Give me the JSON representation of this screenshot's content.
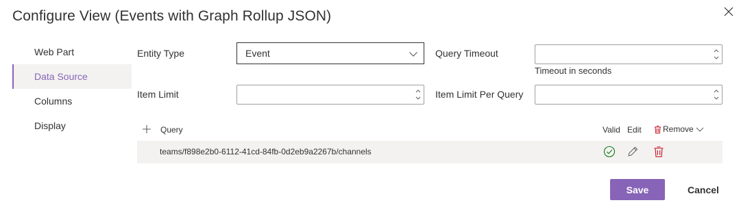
{
  "dialog": {
    "title": "Configure View (Events with Graph Rollup JSON)"
  },
  "nav": {
    "items": [
      {
        "label": "Web Part",
        "selected": false
      },
      {
        "label": "Data Source",
        "selected": true
      },
      {
        "label": "Columns",
        "selected": false
      },
      {
        "label": "Display",
        "selected": false
      }
    ]
  },
  "form": {
    "entity_type_label": "Entity Type",
    "entity_type_value": "Event",
    "query_timeout_label": "Query Timeout",
    "query_timeout_value": "",
    "query_timeout_hint": "Timeout in seconds",
    "item_limit_label": "Item Limit",
    "item_limit_value": "",
    "item_limit_per_query_label": "Item Limit Per Query",
    "item_limit_per_query_value": ""
  },
  "queries": {
    "header": {
      "query": "Query",
      "valid": "Valid",
      "edit": "Edit",
      "remove": "Remove"
    },
    "rows": [
      {
        "query": "teams/f898e2b0-6112-41cd-84fb-0d2eb9a2267b/channels",
        "valid": true
      }
    ]
  },
  "footer": {
    "save_label": "Save",
    "cancel_label": "Cancel"
  },
  "colors": {
    "accent": "#8764b8",
    "valid_green": "#107c10",
    "delete_red": "#c50f1f"
  }
}
